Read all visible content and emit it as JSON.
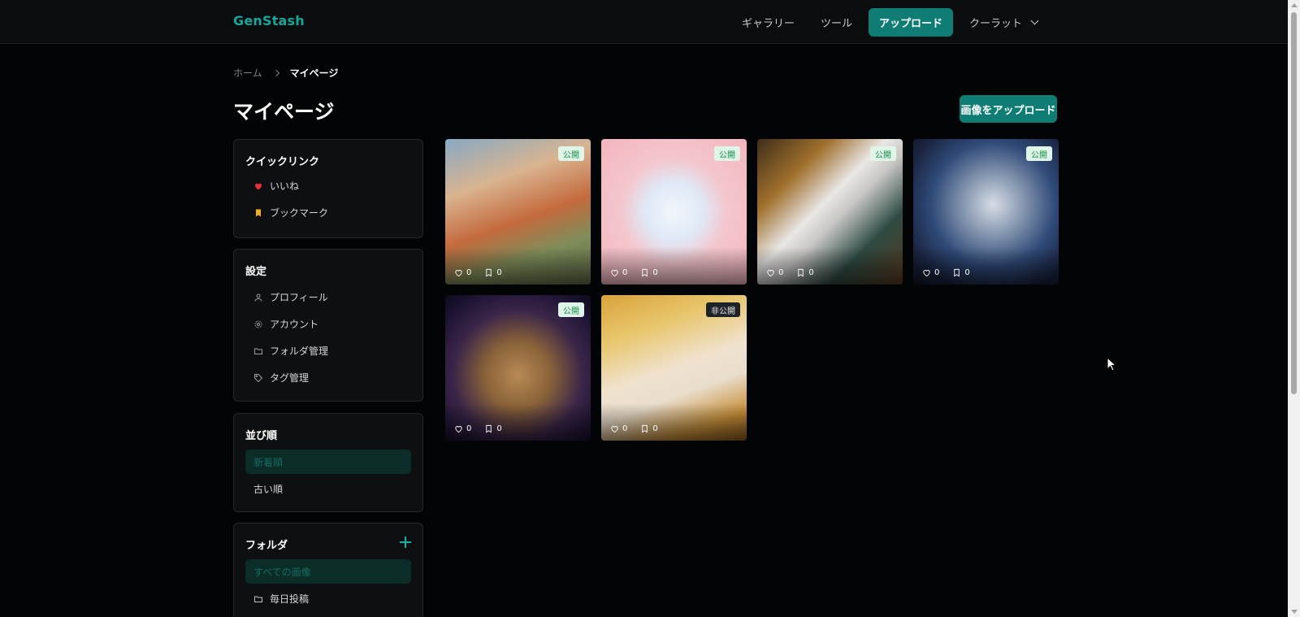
{
  "header": {
    "brand": "GenStash",
    "nav": [
      {
        "label": "ギャラリー"
      },
      {
        "label": "ツール"
      },
      {
        "label": "アップロード"
      }
    ],
    "user": "クーラット"
  },
  "breadcrumb": {
    "home": "ホーム",
    "current": "マイページ"
  },
  "page": {
    "title": "マイページ",
    "upload_button": "画像をアップロード"
  },
  "sidebar": {
    "quick_links": {
      "title": "クイックリンク",
      "items": [
        {
          "label": "いいね",
          "icon": "heart-icon"
        },
        {
          "label": "ブックマーク",
          "icon": "bookmark-icon"
        }
      ]
    },
    "settings": {
      "title": "設定",
      "items": [
        {
          "label": "プロフィール",
          "icon": "user-icon"
        },
        {
          "label": "アカウント",
          "icon": "gear-icon"
        },
        {
          "label": "フォルダ管理",
          "icon": "folder-icon"
        },
        {
          "label": "タグ管理",
          "icon": "tag-icon"
        }
      ]
    },
    "sort": {
      "title": "並び順",
      "items": [
        {
          "label": "新着順"
        },
        {
          "label": "古い順"
        }
      ]
    },
    "folders": {
      "title": "フォルダ",
      "items": [
        {
          "label": "すべての画像"
        },
        {
          "label": "毎日投稿"
        }
      ]
    }
  },
  "gallery": [
    {
      "status": "公開",
      "likes": "0",
      "bookmarks": "0"
    },
    {
      "status": "公開",
      "likes": "0",
      "bookmarks": "0"
    },
    {
      "status": "公開",
      "likes": "0",
      "bookmarks": "0"
    },
    {
      "status": "公開",
      "likes": "0",
      "bookmarks": "0"
    },
    {
      "status": "公開",
      "likes": "0",
      "bookmarks": "0"
    },
    {
      "status": "非公開",
      "likes": "0",
      "bookmarks": "0"
    }
  ],
  "colors": {
    "accent": "#0f7d74",
    "brand": "#14a79a",
    "background": "#030405"
  }
}
